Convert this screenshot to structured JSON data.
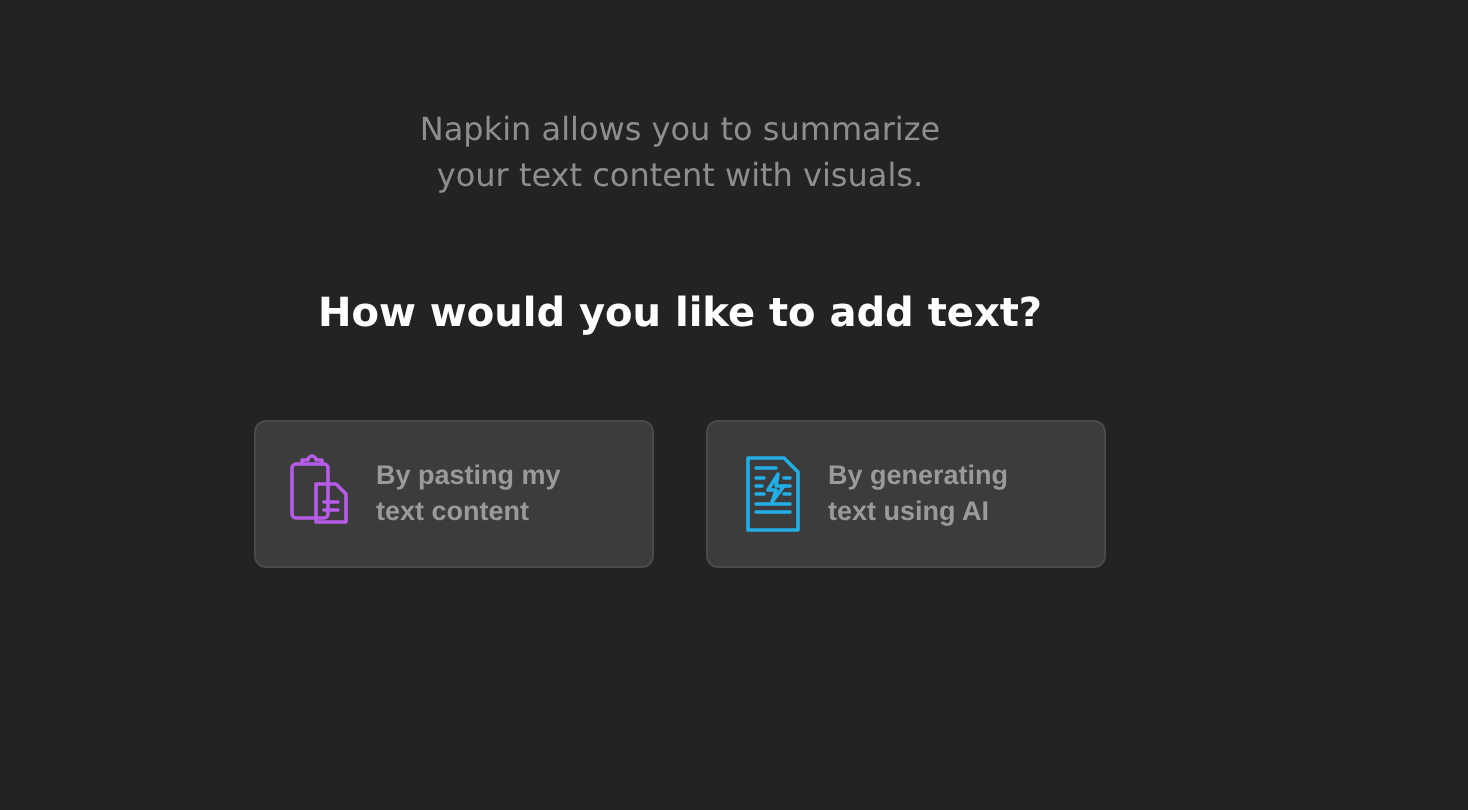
{
  "intro": "Napkin allows you to summarize your text content with visuals.",
  "heading": "How would you like to add text?",
  "options": [
    {
      "kind": "paste",
      "label": "By pasting my text content"
    },
    {
      "kind": "generate",
      "label": "By generating text using AI"
    }
  ]
}
